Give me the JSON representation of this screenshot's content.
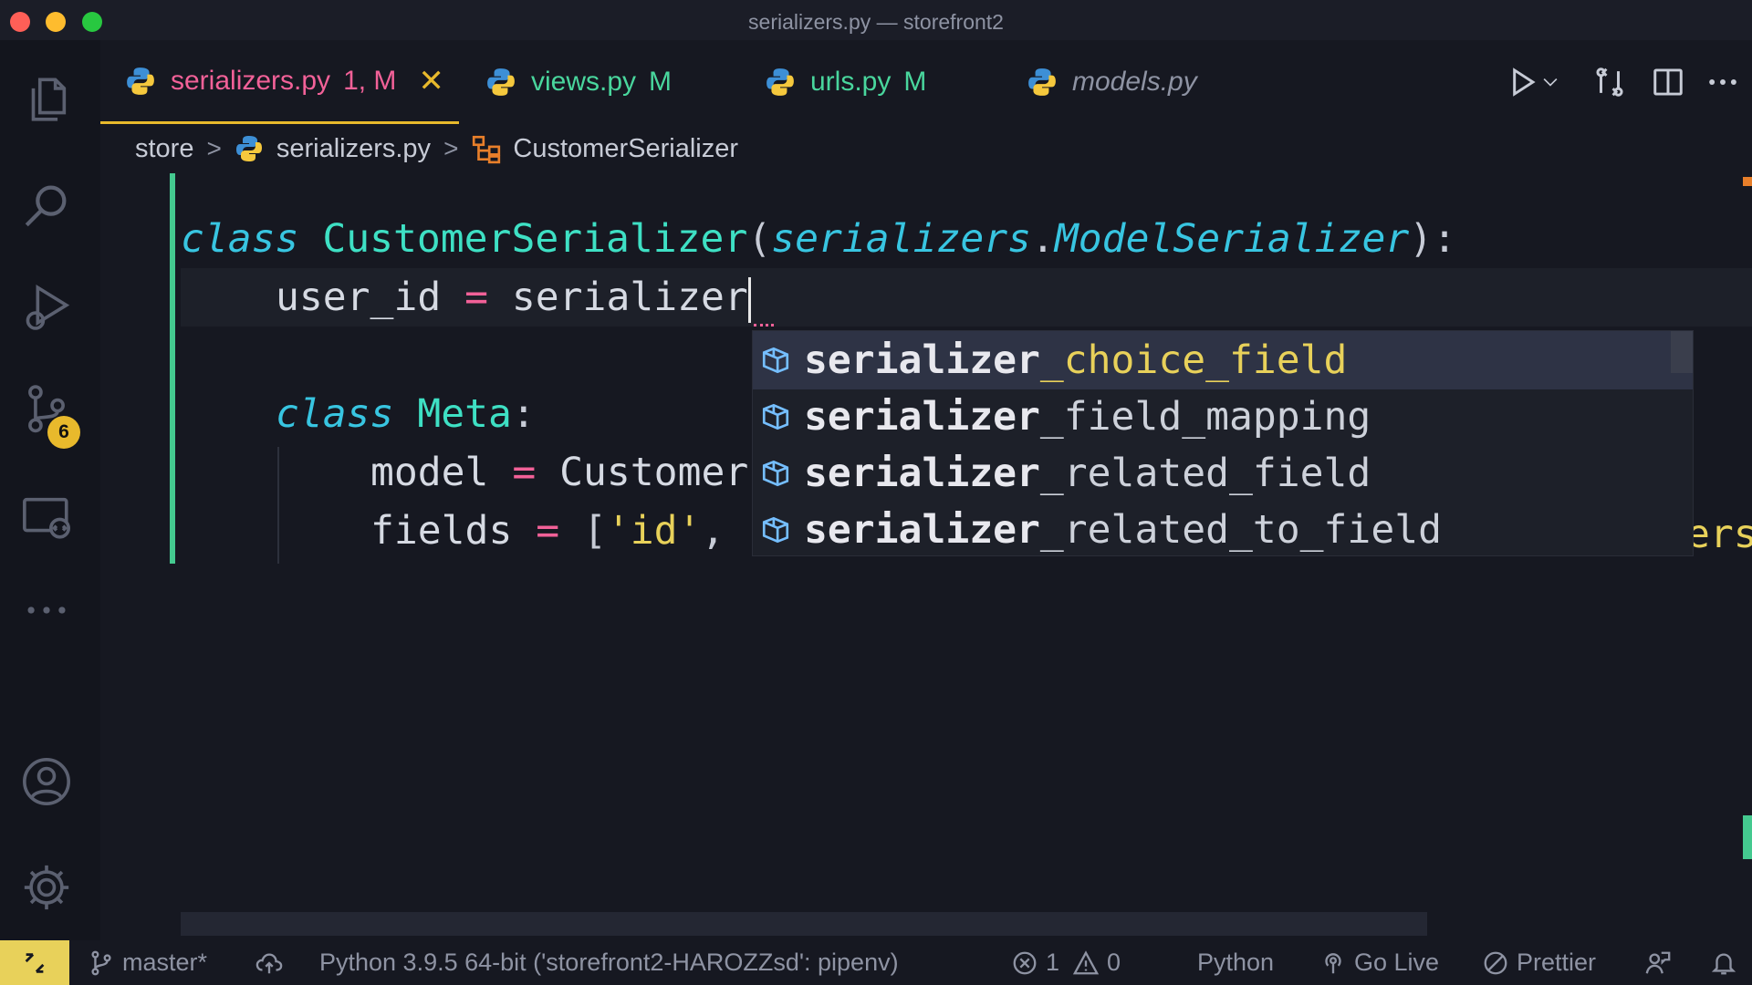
{
  "window": {
    "title": "serializers.py — storefront2"
  },
  "activity_bar": {
    "items": [
      "explorer",
      "search",
      "run-and-debug",
      "source-control",
      "remote-explorer",
      "more"
    ],
    "source_control_badge": "6"
  },
  "tabs": [
    {
      "name": "serializers.py",
      "status": "1, M",
      "active": true,
      "close": "✕"
    },
    {
      "name": "views.py",
      "status": "M"
    },
    {
      "name": "urls.py",
      "status": "M"
    },
    {
      "name": "models.py",
      "status": ""
    }
  ],
  "breadcrumb": {
    "folder": "store",
    "file": "serializers.py",
    "symbol": "CustomerSerializer",
    "separator": ">"
  },
  "code": {
    "line1": {
      "kw": "class",
      "cls": "CustomerSerializer",
      "open": "(",
      "base_module": "serializers",
      "dot": ".",
      "base_class": "ModelSerializer",
      "close": "):"
    },
    "line2": {
      "var": "user_id",
      "eq": "=",
      "partial": "serializer"
    },
    "line4": {
      "kw": "class",
      "cls": "Meta",
      "colon": ":"
    },
    "line5": {
      "var": "model",
      "eq": "=",
      "value": "Customer"
    },
    "line6": {
      "var": "fields",
      "eq": "=",
      "open": "[",
      "str": "'id'",
      "comma": ","
    },
    "overflow": "ersh"
  },
  "suggestions": [
    {
      "match": "serializer",
      "rest": "_choice_field",
      "selected": true
    },
    {
      "match": "serializer",
      "rest": "_field_mapping"
    },
    {
      "match": "serializer",
      "rest": "_related_field"
    },
    {
      "match": "serializer",
      "rest": "_related_to_field"
    }
  ],
  "status_bar": {
    "branch": "master*",
    "interpreter": "Python 3.9.5 64-bit ('storefront2-HAROZZsd': pipenv)",
    "errors": "1",
    "warnings": "0",
    "language": "Python",
    "live": "Go Live",
    "formatter": "Prettier"
  },
  "colors": {
    "accent": "#e8b92c",
    "modified": "#49d69d",
    "error": "#f26198",
    "keyword": "#38c5e1",
    "string": "#e8d15a"
  }
}
